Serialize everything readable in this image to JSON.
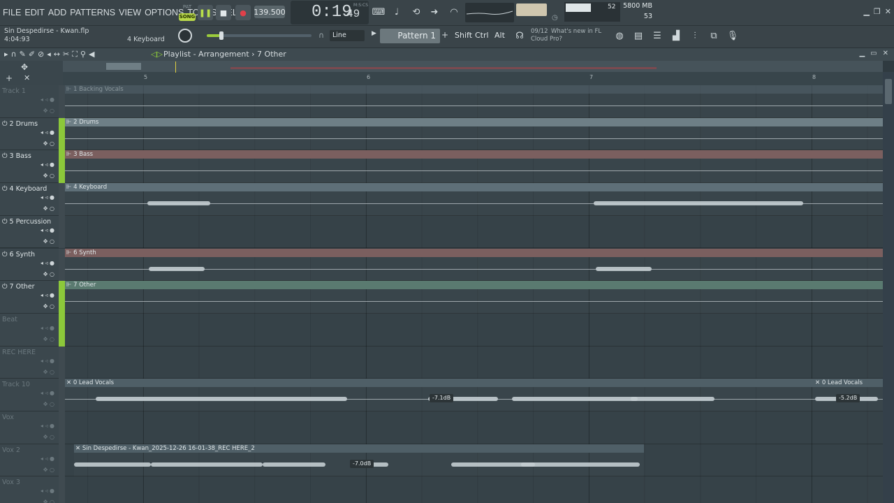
{
  "menu": {
    "items": [
      "FILE",
      "EDIT",
      "ADD",
      "PATTERNS",
      "VIEW",
      "OPTIONS",
      "TOOLS",
      "HELP"
    ]
  },
  "transport": {
    "pat_label": "PAT",
    "song_label": "SONG",
    "tempo": "139.500",
    "time_main": "0:19",
    "time_sub": "49",
    "time_unit": "M:S:CS"
  },
  "monitor": {
    "cpu": "52",
    "polyphony": "53",
    "memory": "5800 MB"
  },
  "project": {
    "name": "Sin Despedirse - Kwan.flp",
    "time": "4:04:93",
    "channel": "4 Keyboard"
  },
  "toolbar": {
    "snap": "Line",
    "pattern": "Pattern 1",
    "keys": [
      "Shift",
      "Ctrl",
      "Alt"
    ],
    "news_date": "09/12",
    "news_line1": "What's new in FL",
    "news_line2": "Cloud Pro?"
  },
  "playlist": {
    "title": "Playlist - Arrangement › 7 Other",
    "bar_numbers": [
      "5",
      "6",
      "7",
      "8"
    ]
  },
  "accent": {
    "green": "#8cc83a",
    "clip_gray": "#6a7a82",
    "clip_red": "#7a5a5a",
    "clip_green": "#5c7a72"
  },
  "tracks": [
    {
      "name": "Track 1",
      "dim": true,
      "active": false,
      "clips": [
        {
          "label": "1 Backing Vocals",
          "color": "#566670",
          "faded": true
        }
      ]
    },
    {
      "name": "2 Drums",
      "dim": false,
      "active": true,
      "clips": [
        {
          "label": "2 Drums",
          "color": "#6e7f86"
        }
      ]
    },
    {
      "name": "3 Bass",
      "dim": false,
      "active": true,
      "clips": [
        {
          "label": "3 Bass",
          "color": "#7b5f5f"
        }
      ]
    },
    {
      "name": "4 Keyboard",
      "dim": false,
      "active": false,
      "clips": [
        {
          "label": "4 Keyboard",
          "color": "#5e6f78"
        }
      ]
    },
    {
      "name": "5 Percussion",
      "dim": false,
      "active": false,
      "clips": []
    },
    {
      "name": "6 Synth",
      "dim": false,
      "active": false,
      "clips": [
        {
          "label": "6 Synth",
          "color": "#7b5f5f"
        }
      ]
    },
    {
      "name": "7 Other",
      "dim": false,
      "active": true,
      "clips": [
        {
          "label": "7 Other",
          "color": "#5a7a70"
        }
      ]
    },
    {
      "name": "Beat",
      "dim": true,
      "active": true,
      "clips": []
    },
    {
      "name": "REC HERE",
      "dim": true,
      "active": false,
      "clips": []
    },
    {
      "name": "Track 10",
      "dim": true,
      "active": false,
      "clips": [
        {
          "label": "0 Lead Vocals",
          "color": "#4f5f67",
          "db": "-7.1dB"
        },
        {
          "label": "0 Lead Vocals",
          "color": "#4f5f67",
          "db": "-5.2dB"
        }
      ]
    },
    {
      "name": "Vox",
      "dim": true,
      "active": false,
      "clips": []
    },
    {
      "name": "Vox 2",
      "dim": true,
      "active": false,
      "clips": [
        {
          "label": "Sin Despedirse - Kwan_2025-12-26 16-01-38_REC HERE_2",
          "color": "#4f5f67",
          "db": "-7.0dB"
        }
      ]
    },
    {
      "name": "Vox 3",
      "dim": true,
      "active": false,
      "clips": []
    }
  ]
}
